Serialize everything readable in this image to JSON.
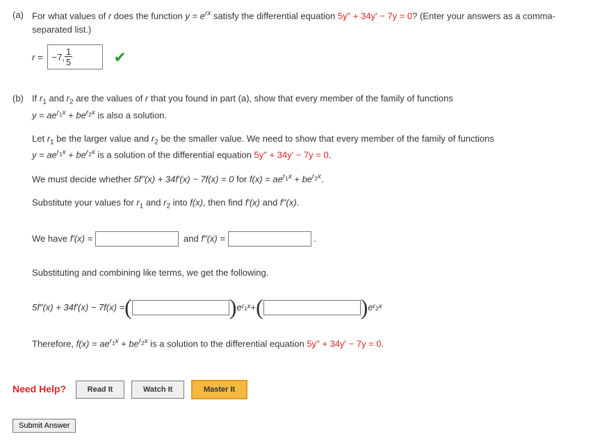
{
  "partA": {
    "label": "(a)",
    "question_prefix": "For what values of ",
    "r_var": "r",
    "question_mid1": " does the function ",
    "func_lhs": "y",
    "eq_sign": " = ",
    "func_rhs_base": "e",
    "func_rhs_exp": "rx",
    "question_mid2": " satisfy the differential equation ",
    "diffeq": "5y\" + 34y' − 7y = 0",
    "question_suffix": "? (Enter your answers as a comma-separated list.)",
    "answer_label": "r = ",
    "answer_value_neg7": "−7, ",
    "answer_frac_num": "1",
    "answer_frac_den": "5"
  },
  "partB": {
    "label": "(b)",
    "intro_1": "If ",
    "r1_base": "r",
    "r1_sub": "1",
    "intro_2": " and ",
    "r2_base": "r",
    "r2_sub": "2",
    "intro_3": " are the values of ",
    "r_var": "r",
    "intro_4": " that you found in part (a), show that every member of the family of functions ",
    "family_lhs": "y",
    "eq_sign": " = ",
    "family_a": "ae",
    "family_r1exp": "r",
    "family_r1exp_sub": "1",
    "family_r1exp_x": "x",
    "plus": " + ",
    "family_b": "be",
    "family_r2exp": "r",
    "family_r2exp_sub": "2",
    "family_r2exp_x": "x",
    "intro_5": " is also a solution.",
    "para2_1": "Let ",
    "para2_2": " be the larger value and ",
    "para2_3": " be the smaller value. We need to show that every member of the family of functions ",
    "para2_4": " is a solution of the differential equation ",
    "diffeq": "5y\" + 34y' − 7y = 0",
    "para2_5": ".",
    "para3_1": "We must decide whether ",
    "para3_eq": "5f\"(x) + 34f'(x) − 7f(x) = 0",
    "para3_2": " for ",
    "para3_fx": "f(x)",
    "para3_3": ".",
    "para4_1": "Substitute your values for ",
    "para4_2": " into ",
    "para4_fx": "f(x)",
    "para4_3": ", then find ",
    "para4_fp": "f'(x)",
    "para4_4": " and ",
    "para4_fpp": "f''(x)",
    "para4_5": ".",
    "para5_1": "We have ",
    "para5_fp": "f'(x) = ",
    "para5_2": " and ",
    "para5_fpp": "f\"(x) = ",
    "para5_3": " .",
    "para6": "Substituting and combining like terms, we get the following.",
    "para7_lhs": "5f\"(x) + 34f'(x) − 7f(x) = ",
    "para7_e1": "e",
    "para7_mid": " + ",
    "para7_e2": "e",
    "para8_1": "Therefore, ",
    "para8_fx": "f(x)",
    "para8_2": " is a solution to the differential equation ",
    "para8_3": "."
  },
  "help": {
    "label": "Need Help?",
    "read": "Read It",
    "watch": "Watch It",
    "master": "Master It"
  },
  "submit": {
    "label": "Submit Answer"
  }
}
